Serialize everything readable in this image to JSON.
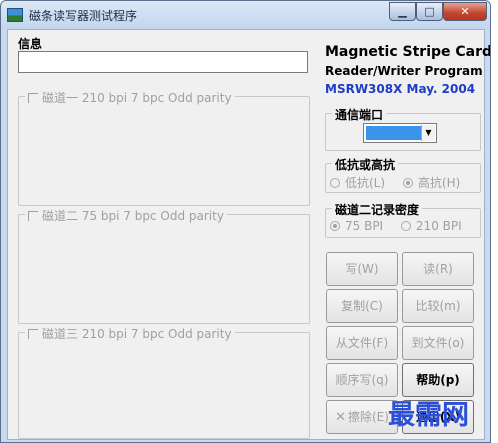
{
  "window": {
    "title": "磁条读写器测试程序",
    "minimize_glyph": "▁",
    "maximize_glyph": "□",
    "close_glyph": "✕"
  },
  "info": {
    "label": "信息",
    "value": ""
  },
  "tracks": [
    {
      "label": "磁道一 210 bpi 7 bpc  Odd parity"
    },
    {
      "label": "磁道二  75 bpi 7 bpc  Odd parity"
    },
    {
      "label": "磁道三 210 bpi 7 bpc  Odd parity"
    }
  ],
  "program": {
    "line1": "Magnetic Stripe Card",
    "line2": "Reader/Writer Program",
    "line3": "MSRW308X May. 2004"
  },
  "port": {
    "label": "通信端口",
    "arrow_glyph": "▼"
  },
  "coercivity": {
    "label": "低抗或高抗",
    "low": "低抗(L)",
    "high": "高抗(H)",
    "selected": "high"
  },
  "track2_density": {
    "label": "磁道二记录密度",
    "opt75": "75 BPI",
    "opt210": "210 BPI",
    "selected": "75 BPI"
  },
  "buttons": {
    "write": "写(W)",
    "read": "读(R)",
    "copy": "复制(C)",
    "compare": "比较(m)",
    "from_file": "从文件(F)",
    "to_file": "到文件(o)",
    "seq_write": "顺序写(q)",
    "help": "帮助(p)",
    "erase": "擦除(E)",
    "exit": "退出(X)",
    "erase_icon_glyph": "✕"
  },
  "watermark": "最需网",
  "colors": {
    "port_fill": "#3a94ec",
    "program_line3": "#1e3cc8",
    "close_button": "#c2452d",
    "watermark": "#2a4fd8"
  }
}
